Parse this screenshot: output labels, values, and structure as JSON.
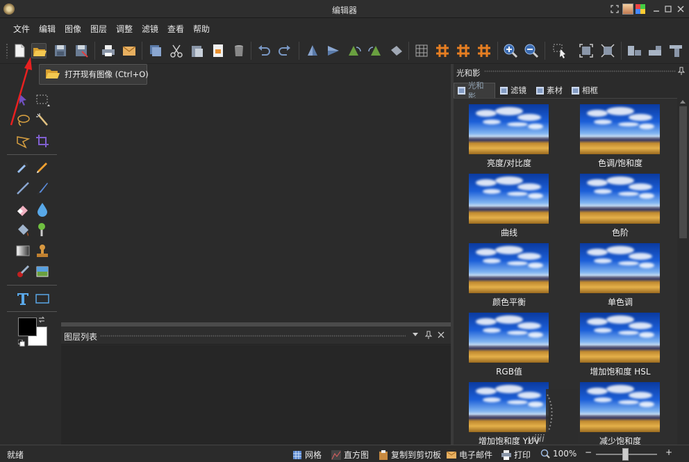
{
  "window": {
    "title": "编辑器"
  },
  "menu": [
    "文件",
    "编辑",
    "图像",
    "图层",
    "调整",
    "滤镜",
    "查看",
    "帮助"
  ],
  "toolbar": {
    "icons": [
      "new-file-icon",
      "open-file-icon",
      "save-icon",
      "save-as-icon",
      "print-icon",
      "email-icon",
      "copy-icon",
      "cut-icon",
      "paste-icon",
      "paste-new-icon",
      "trash-icon",
      "undo-icon",
      "redo-icon",
      "flip-vertical-icon",
      "flip-horizontal-icon",
      "rotate-left-icon",
      "rotate-right-icon",
      "free-rotate-icon",
      "grid-icon",
      "grid-orange-1-icon",
      "grid-orange-2-icon",
      "grid-orange-3-icon",
      "zoom-in-icon",
      "zoom-out-icon",
      "select-pointer-icon",
      "fit-window-icon",
      "actual-size-icon",
      "align-left-icon",
      "align-center-icon",
      "align-right-icon"
    ]
  },
  "tooltip": {
    "text": "打开现有图像 (Ctrl+O)"
  },
  "layers_panel": {
    "title": "图层列表"
  },
  "right_panel": {
    "title": "光和影",
    "tabs": [
      {
        "label": "光和影",
        "active": true
      },
      {
        "label": "滤镜",
        "active": false
      },
      {
        "label": "素材",
        "active": false
      },
      {
        "label": "相框",
        "active": false
      }
    ],
    "effects": [
      "亮度/对比度",
      "色调/饱和度",
      "曲线",
      "色阶",
      "颜色平衡",
      "单色调",
      "RGB值",
      "增加饱和度 HSL",
      "增加饱和度 YUV",
      "减少饱和度"
    ]
  },
  "statusbar": {
    "status": "就绪",
    "grid": "网格",
    "histogram": "直方图",
    "copy_clipboard": "复制到剪切板",
    "email": "电子邮件",
    "print": "打印",
    "zoom": "100%",
    "zoom_minus": "−",
    "zoom_plus": "+",
    "zoom_level": 0.48
  },
  "colors": {
    "foreground": "#000000",
    "background": "#ffffff",
    "accent": "#e67e22"
  }
}
